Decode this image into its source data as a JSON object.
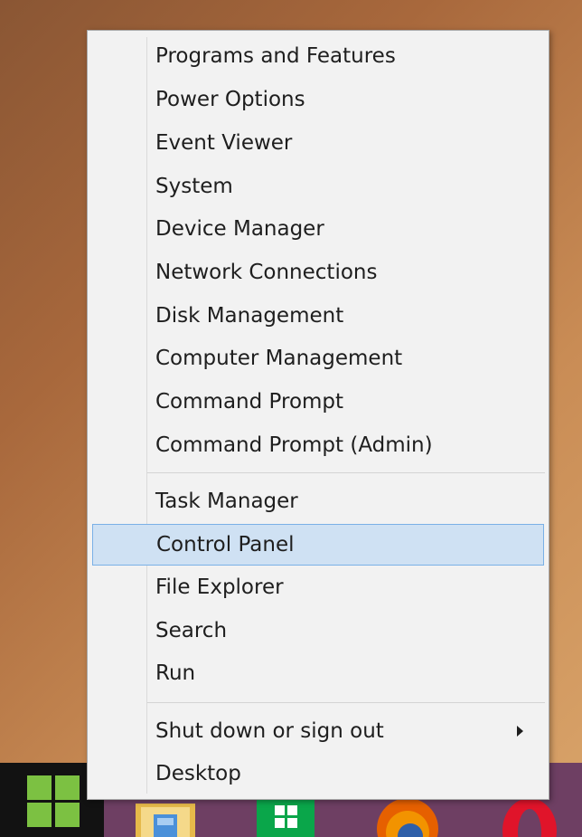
{
  "menu": {
    "group1": [
      {
        "label": "Programs and Features"
      },
      {
        "label": "Power Options"
      },
      {
        "label": "Event Viewer"
      },
      {
        "label": "System"
      },
      {
        "label": "Device Manager"
      },
      {
        "label": "Network Connections"
      },
      {
        "label": "Disk Management"
      },
      {
        "label": "Computer Management"
      },
      {
        "label": "Command Prompt"
      },
      {
        "label": "Command Prompt (Admin)"
      }
    ],
    "group2": [
      {
        "label": "Task Manager"
      },
      {
        "label": "Control Panel",
        "selected": true
      },
      {
        "label": "File Explorer"
      },
      {
        "label": "Search"
      },
      {
        "label": "Run"
      }
    ],
    "group3": [
      {
        "label": "Shut down or sign out",
        "has_submenu": true
      },
      {
        "label": "Desktop"
      }
    ]
  },
  "taskbar": {
    "icons": [
      "windows-start-icon",
      "file-explorer-icon",
      "store-icon",
      "firefox-icon",
      "opera-icon"
    ]
  },
  "colors": {
    "menu_background": "#f2f2f2",
    "selection_background": "#cfe1f3",
    "selection_border": "#7ab0e6",
    "taskbar": "#6e3f63",
    "start_logo": "#7cc142"
  }
}
